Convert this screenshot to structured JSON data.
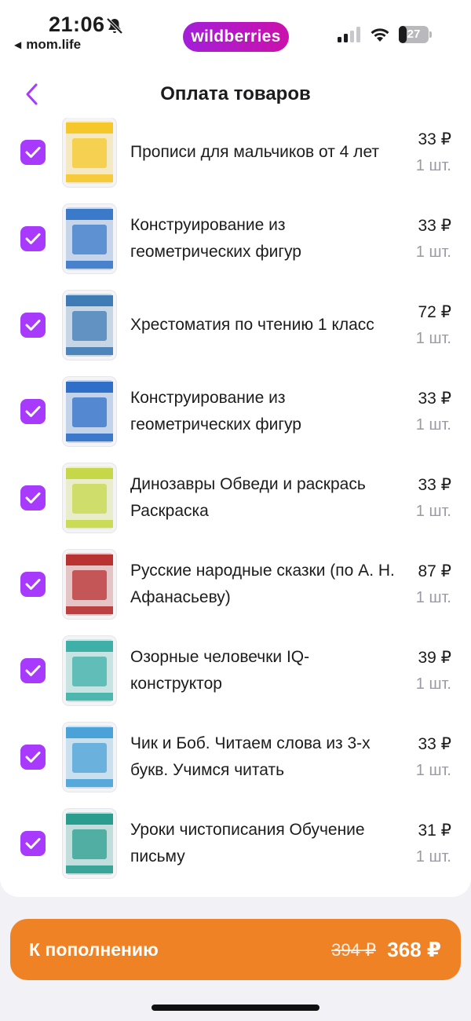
{
  "status_bar": {
    "time": "21:06",
    "back_app": "mom.life",
    "brand": "wildberries",
    "battery": 27,
    "brand_color": "#a21fd8"
  },
  "nav": {
    "title": "Оплата товаров",
    "accent_color": "#a73afd"
  },
  "items": [
    {
      "title": "Прописи для мальчиков от 4 лет",
      "price": "33 ₽",
      "qty": "1 шт.",
      "checked": true,
      "thumb_color": "#f6c72b"
    },
    {
      "title": "Конструирование из геометрических фигур",
      "price": "33 ₽",
      "qty": "1 шт.",
      "checked": true,
      "thumb_color": "#3b79c9"
    },
    {
      "title": "Хрестоматия по чтению 1 класс",
      "price": "72 ₽",
      "qty": "1 шт.",
      "checked": true,
      "thumb_color": "#3f7bb5"
    },
    {
      "title": "Конструирование из геометрических фигур",
      "price": "33 ₽",
      "qty": "1 шт.",
      "checked": true,
      "thumb_color": "#2f6fc7"
    },
    {
      "title": "Динозавры Обведи и раскрась Раскраска",
      "price": "33 ₽",
      "qty": "1 шт.",
      "checked": true,
      "thumb_color": "#c6d84a"
    },
    {
      "title": "Русские народные сказки (по А. Н. Афанасьеву)",
      "price": "87 ₽",
      "qty": "1 шт.",
      "checked": true,
      "thumb_color": "#b83232"
    },
    {
      "title": "Озорные человечки IQ-конструктор",
      "price": "39 ₽",
      "qty": "1 шт.",
      "checked": true,
      "thumb_color": "#3fb0a8"
    },
    {
      "title": "Чик и Боб. Читаем слова из 3-х букв. Учимся читать",
      "price": "33 ₽",
      "qty": "1 шт.",
      "checked": true,
      "thumb_color": "#4aa2d8"
    },
    {
      "title": "Уроки чистописания Обучение письму",
      "price": "31 ₽",
      "qty": "1 шт.",
      "checked": true,
      "thumb_color": "#2a9d8f"
    }
  ],
  "pay_button": {
    "label": "К пополнению",
    "old_total": "394 ₽",
    "new_total": "368 ₽",
    "color": "#f08226"
  }
}
